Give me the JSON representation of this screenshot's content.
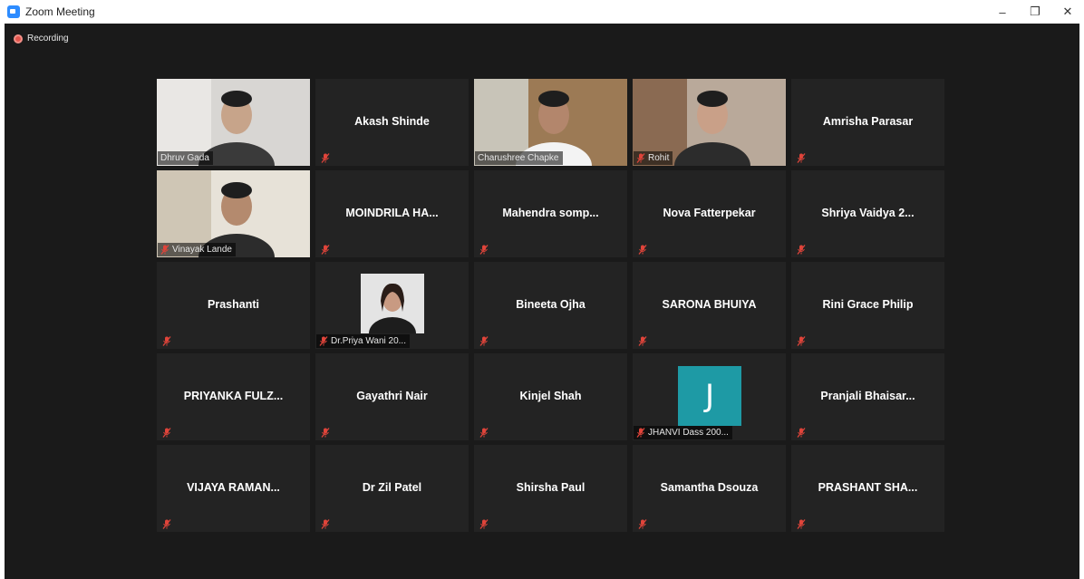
{
  "window": {
    "title": "Zoom Meeting",
    "minimize": "–",
    "restore": "❐",
    "close": "✕"
  },
  "recording": {
    "label": "Recording"
  },
  "tiles": [
    {
      "name": "Dhruv Gada",
      "kind": "video"
    },
    {
      "name": "Akash Shinde",
      "kind": "name"
    },
    {
      "name": "Charushree Chapke",
      "kind": "video",
      "active": true
    },
    {
      "name": "Rohit",
      "kind": "video"
    },
    {
      "name": "Amrisha Parasar",
      "kind": "name"
    },
    {
      "name": "Vinayak Lande",
      "kind": "video"
    },
    {
      "name": "MOINDRILA HA...",
      "kind": "name"
    },
    {
      "name": "Mahendra  somp...",
      "kind": "name"
    },
    {
      "name": "Nova Fatterpekar",
      "kind": "name"
    },
    {
      "name": "Shriya Vaidya 2...",
      "kind": "name"
    },
    {
      "name": "Prashanti",
      "kind": "name"
    },
    {
      "name": "Dr.Priya Wani 20...",
      "kind": "photo"
    },
    {
      "name": "Bineeta Ojha",
      "kind": "name"
    },
    {
      "name": "SARONA BHUIYA",
      "kind": "name"
    },
    {
      "name": "Rini Grace Philip",
      "kind": "name"
    },
    {
      "name": "PRIYANKA  FULZ...",
      "kind": "name"
    },
    {
      "name": "Gayathri Nair",
      "kind": "name"
    },
    {
      "name": "Kinjel Shah",
      "kind": "name"
    },
    {
      "name": "JHANVI Dass 200...",
      "kind": "avatar",
      "initial": "J"
    },
    {
      "name": "Pranjali  Bhaisar...",
      "kind": "name"
    },
    {
      "name": "VIJAYA RAMAN...",
      "kind": "name"
    },
    {
      "name": "Dr Zil Patel",
      "kind": "name"
    },
    {
      "name": "Shirsha Paul",
      "kind": "name"
    },
    {
      "name": "Samantha Dsouza",
      "kind": "name"
    },
    {
      "name": "PRASHANT  SHA...",
      "kind": "name"
    }
  ],
  "colors": {
    "accent": "#2d8cff",
    "muted": "#e0443a",
    "active_border": "#d7e08a",
    "avatar_bg": "#1e9aa5"
  }
}
